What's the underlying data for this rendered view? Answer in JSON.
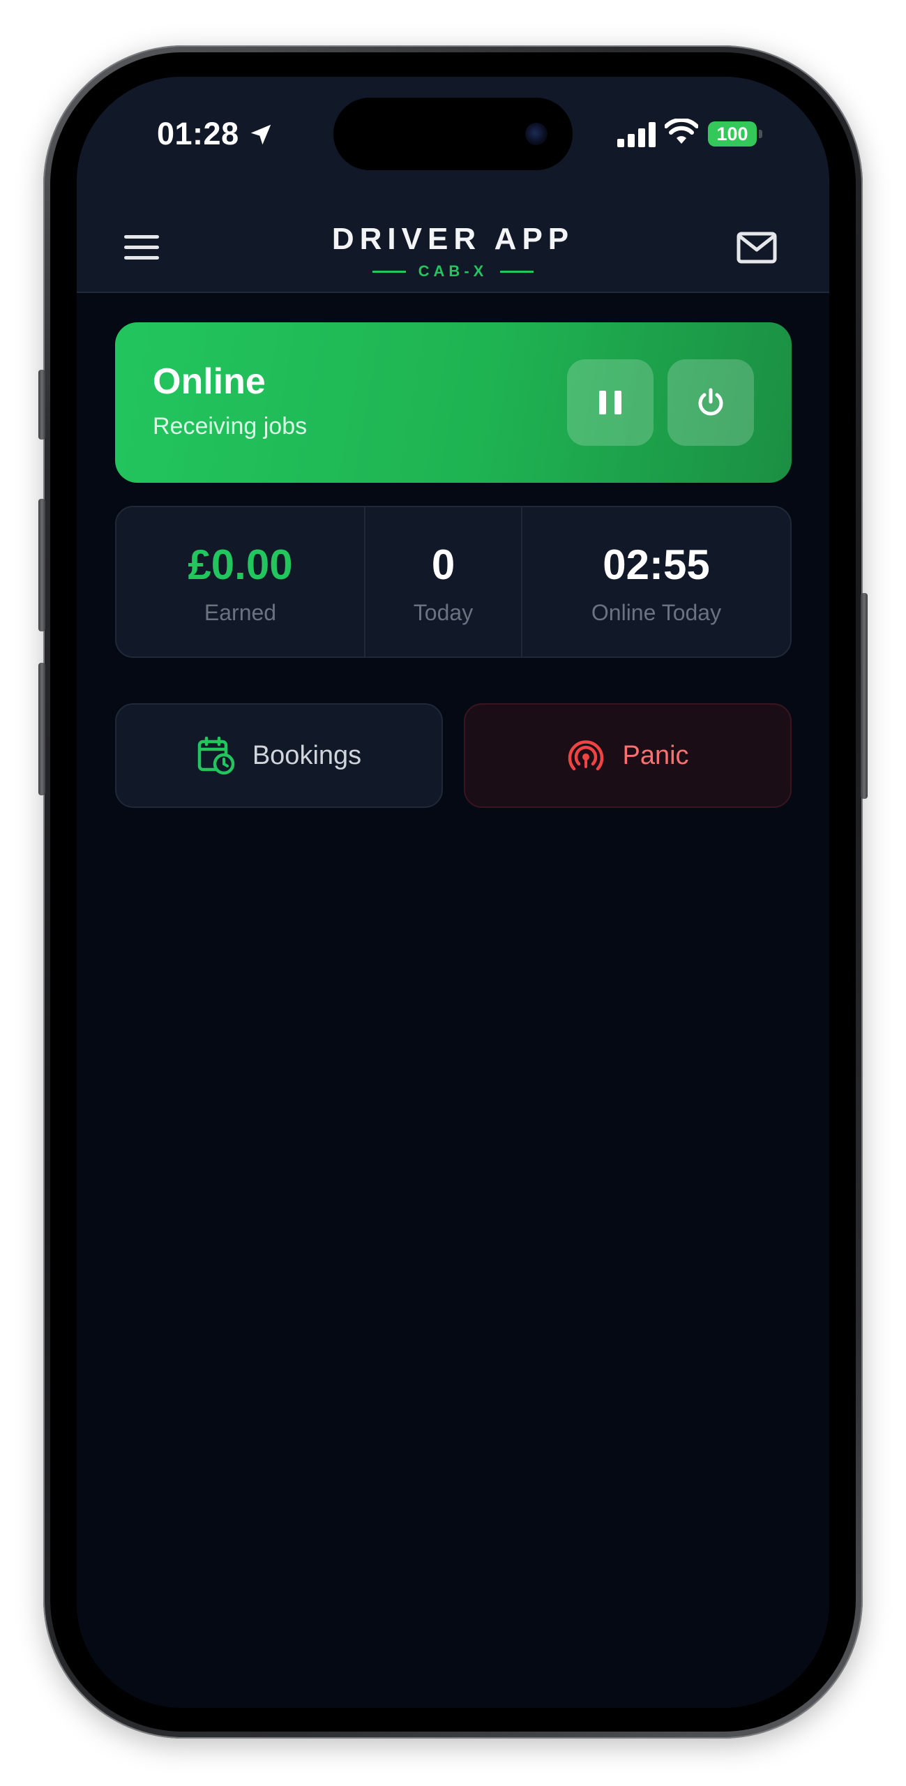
{
  "status_bar": {
    "time": "01:28",
    "battery": "100"
  },
  "header": {
    "title": "DRIVER APP",
    "subtitle": "CAB-X"
  },
  "status_card": {
    "title": "Online",
    "subtitle": "Receiving jobs"
  },
  "stats": [
    {
      "value": "£0.00",
      "label": "Earned"
    },
    {
      "value": "0",
      "label": "Today"
    },
    {
      "value": "02:55",
      "label": "Online Today"
    }
  ],
  "actions": {
    "bookings_label": "Bookings",
    "panic_label": "Panic"
  },
  "colors": {
    "accent_green": "#22c55e",
    "panic_red": "#f87171",
    "background": "#050913",
    "surface": "#111827"
  },
  "icons": {
    "menu": "hamburger-icon",
    "mail": "mail-icon",
    "pause": "pause-icon",
    "power": "power-icon",
    "bookings": "calendar-clock-icon",
    "panic": "broadcast-icon",
    "location": "location-arrow-icon",
    "signal": "cellular-signal-icon",
    "wifi": "wifi-icon",
    "battery": "battery-icon"
  }
}
